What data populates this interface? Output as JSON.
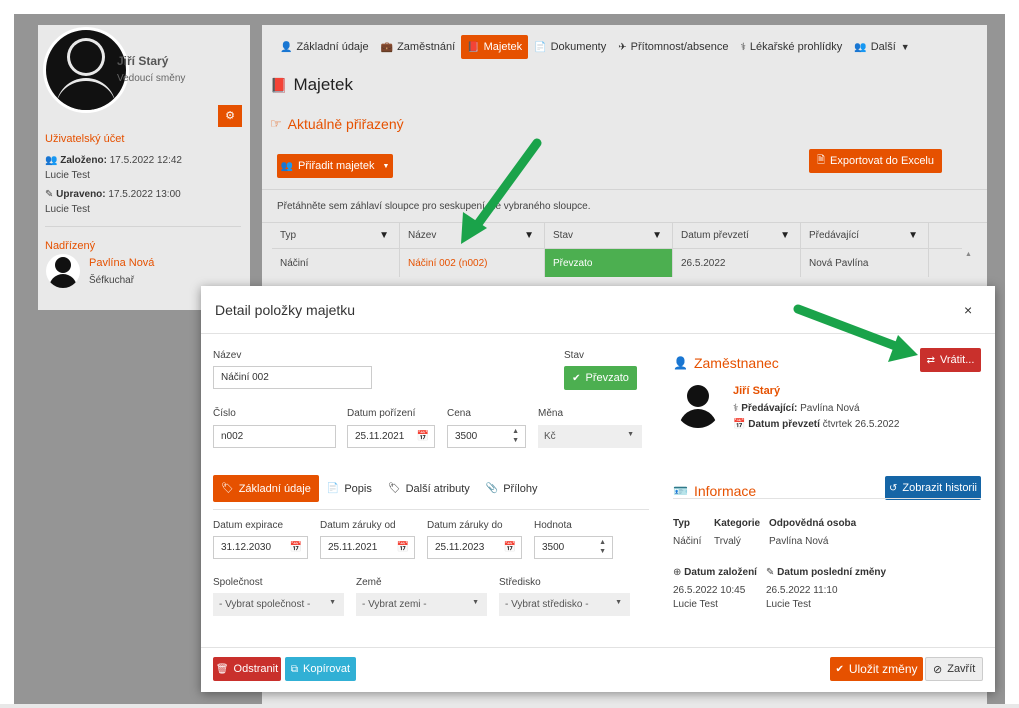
{
  "profile": {
    "name": "Jiří Starý",
    "role": "Vedoucí směny",
    "account_title": "Uživatelský účet",
    "created_label": "Založeno:",
    "created_value": "17.5.2022 12:42",
    "created_by": "Lucie Test",
    "updated_label": "Upraveno:",
    "updated_value": "17.5.2022 13:00",
    "updated_by": "Lucie Test",
    "superior_title": "Nadřízený",
    "superior_name": "Pavlína Nová",
    "superior_role": "Šéfkuchař"
  },
  "tabs": [
    {
      "label": "Základní údaje",
      "icon": "person-icon"
    },
    {
      "label": "Zaměstnání",
      "icon": "briefcase-icon"
    },
    {
      "label": "Majetek",
      "icon": "book-icon"
    },
    {
      "label": "Dokumenty",
      "icon": "file-icon"
    },
    {
      "label": "Přítomnost/absence",
      "icon": "plane-icon"
    },
    {
      "label": "Lékařské prohlídky",
      "icon": "doctor-icon"
    },
    {
      "label": "Další",
      "icon": "users-icon"
    }
  ],
  "main": {
    "title": "Majetek",
    "assigned_title": "Aktuálně přiřazený",
    "assign_button": "Přiřadit majetek",
    "export_button": "Exportovat do Excelu",
    "group_hint": "Přetáhněte sem záhlaví sloupce pro seskupení dle vybraného sloupce."
  },
  "grid": {
    "columns": [
      "Typ",
      "Název",
      "Stav",
      "Datum převzetí",
      "Předávající"
    ],
    "rows": [
      [
        "Náčiní",
        "Náčiní 002 (n002)",
        "Převzato",
        "26.5.2022",
        "Nová Pavlína"
      ]
    ]
  },
  "modal": {
    "title": "Detail položky majetku",
    "close": "×",
    "name_label": "Název",
    "name_value": "Náčiní 002",
    "status_label": "Stav",
    "status_value": "Převzato",
    "number_label": "Číslo",
    "number_value": "n002",
    "acquired_label": "Datum pořízení",
    "acquired_value": "25.11.2021",
    "price_label": "Cena",
    "price_value": "3500",
    "currency_label": "Měna",
    "currency_value": "Kč",
    "subtabs": [
      "Základní údaje",
      "Popis",
      "Další atributy",
      "Přílohy"
    ],
    "expiry_label": "Datum expirace",
    "expiry_value": "31.12.2030",
    "warranty_from_label": "Datum záruky od",
    "warranty_from_value": "25.11.2021",
    "warranty_to_label": "Datum záruky do",
    "warranty_to_value": "25.11.2023",
    "value_label": "Hodnota",
    "value_value": "3500",
    "company_label": "Společnost",
    "company_value": "- Vybrat společnost -",
    "country_label": "Země",
    "country_value": "- Vybrat zemi -",
    "center_label": "Středisko",
    "center_value": "- Vybrat středisko -",
    "employee_title": "Zaměstnanec",
    "return_button": "Vrátit...",
    "employee_name": "Jiří Starý",
    "handover_label": "Předávající:",
    "handover_value": "Pavlína Nová",
    "takeover_label": "Datum převzetí",
    "takeover_value": "čtvrtek 26.5.2022",
    "info_title": "Informace",
    "history_button": "Zobrazit historii",
    "type_label": "Typ",
    "type_value": "Náčiní",
    "category_label": "Kategorie",
    "category_value": "Trvalý",
    "responsible_label": "Odpovědná osoba",
    "responsible_value": "Pavlína Nová",
    "created_label": "Datum založení",
    "created_value": "26.5.2022 10:45",
    "created_by": "Lucie Test",
    "changed_label": "Datum poslední změny",
    "changed_value": "26.5.2022 11:10",
    "changed_by": "Lucie Test",
    "delete_button": "Odstranit",
    "copy_button": "Kopírovat",
    "save_button": "Uložit změny",
    "close_button": "Zavřít"
  },
  "colors": {
    "accent": "#e65100",
    "status_green": "#4caf50",
    "danger": "#c9302c",
    "info": "#1565a6",
    "teal": "#31b0d5",
    "annotation_arrow": "#1aa34a"
  }
}
